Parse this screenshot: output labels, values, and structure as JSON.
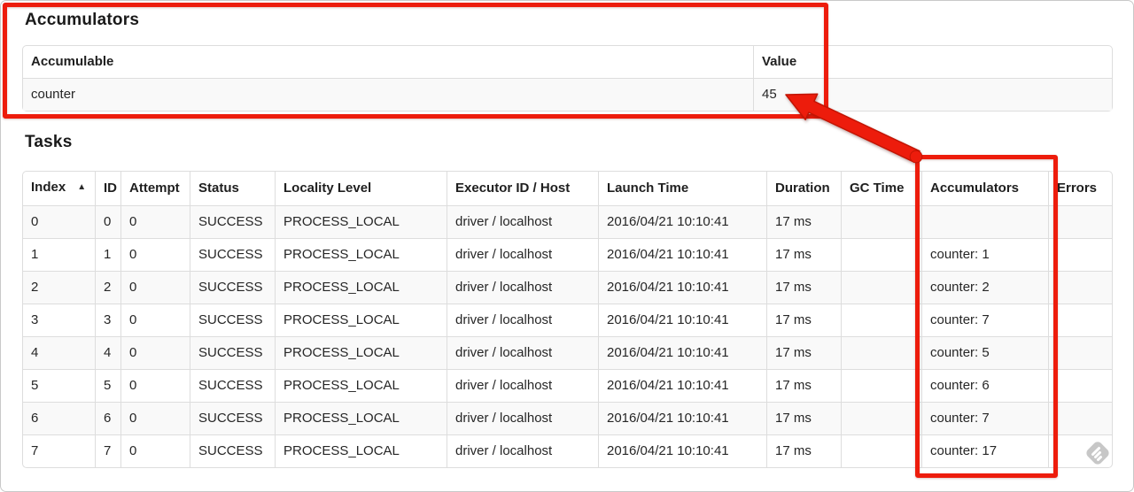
{
  "accumulators_section": {
    "title": "Accumulators",
    "table": {
      "headers": [
        "Accumulable",
        "Value"
      ],
      "rows": [
        {
          "accumulable": "counter",
          "value": "45"
        }
      ]
    }
  },
  "tasks_section": {
    "title": "Tasks",
    "table": {
      "headers": [
        "Index",
        "ID",
        "Attempt",
        "Status",
        "Locality Level",
        "Executor ID / Host",
        "Launch Time",
        "Duration",
        "GC Time",
        "Accumulators",
        "Errors"
      ],
      "sort_icon": "▲",
      "rows": [
        {
          "index": "0",
          "id": "0",
          "attempt": "0",
          "status": "SUCCESS",
          "locality": "PROCESS_LOCAL",
          "executor": "driver / localhost",
          "launch": "2016/04/21 10:10:41",
          "duration": "17 ms",
          "gc": "",
          "accumulators": "",
          "errors": ""
        },
        {
          "index": "1",
          "id": "1",
          "attempt": "0",
          "status": "SUCCESS",
          "locality": "PROCESS_LOCAL",
          "executor": "driver / localhost",
          "launch": "2016/04/21 10:10:41",
          "duration": "17 ms",
          "gc": "",
          "accumulators": "counter: 1",
          "errors": ""
        },
        {
          "index": "2",
          "id": "2",
          "attempt": "0",
          "status": "SUCCESS",
          "locality": "PROCESS_LOCAL",
          "executor": "driver / localhost",
          "launch": "2016/04/21 10:10:41",
          "duration": "17 ms",
          "gc": "",
          "accumulators": "counter: 2",
          "errors": ""
        },
        {
          "index": "3",
          "id": "3",
          "attempt": "0",
          "status": "SUCCESS",
          "locality": "PROCESS_LOCAL",
          "executor": "driver / localhost",
          "launch": "2016/04/21 10:10:41",
          "duration": "17 ms",
          "gc": "",
          "accumulators": "counter: 7",
          "errors": ""
        },
        {
          "index": "4",
          "id": "4",
          "attempt": "0",
          "status": "SUCCESS",
          "locality": "PROCESS_LOCAL",
          "executor": "driver / localhost",
          "launch": "2016/04/21 10:10:41",
          "duration": "17 ms",
          "gc": "",
          "accumulators": "counter: 5",
          "errors": ""
        },
        {
          "index": "5",
          "id": "5",
          "attempt": "0",
          "status": "SUCCESS",
          "locality": "PROCESS_LOCAL",
          "executor": "driver / localhost",
          "launch": "2016/04/21 10:10:41",
          "duration": "17 ms",
          "gc": "",
          "accumulators": "counter: 6",
          "errors": ""
        },
        {
          "index": "6",
          "id": "6",
          "attempt": "0",
          "status": "SUCCESS",
          "locality": "PROCESS_LOCAL",
          "executor": "driver / localhost",
          "launch": "2016/04/21 10:10:41",
          "duration": "17 ms",
          "gc": "",
          "accumulators": "counter: 7",
          "errors": ""
        },
        {
          "index": "7",
          "id": "7",
          "attempt": "0",
          "status": "SUCCESS",
          "locality": "PROCESS_LOCAL",
          "executor": "driver / localhost",
          "launch": "2016/04/21 10:10:41",
          "duration": "17 ms",
          "gc": "",
          "accumulators": "counter: 17",
          "errors": ""
        }
      ]
    }
  },
  "annotations": {
    "color": "#ed1c0c",
    "stroke_color": "#c21504"
  }
}
